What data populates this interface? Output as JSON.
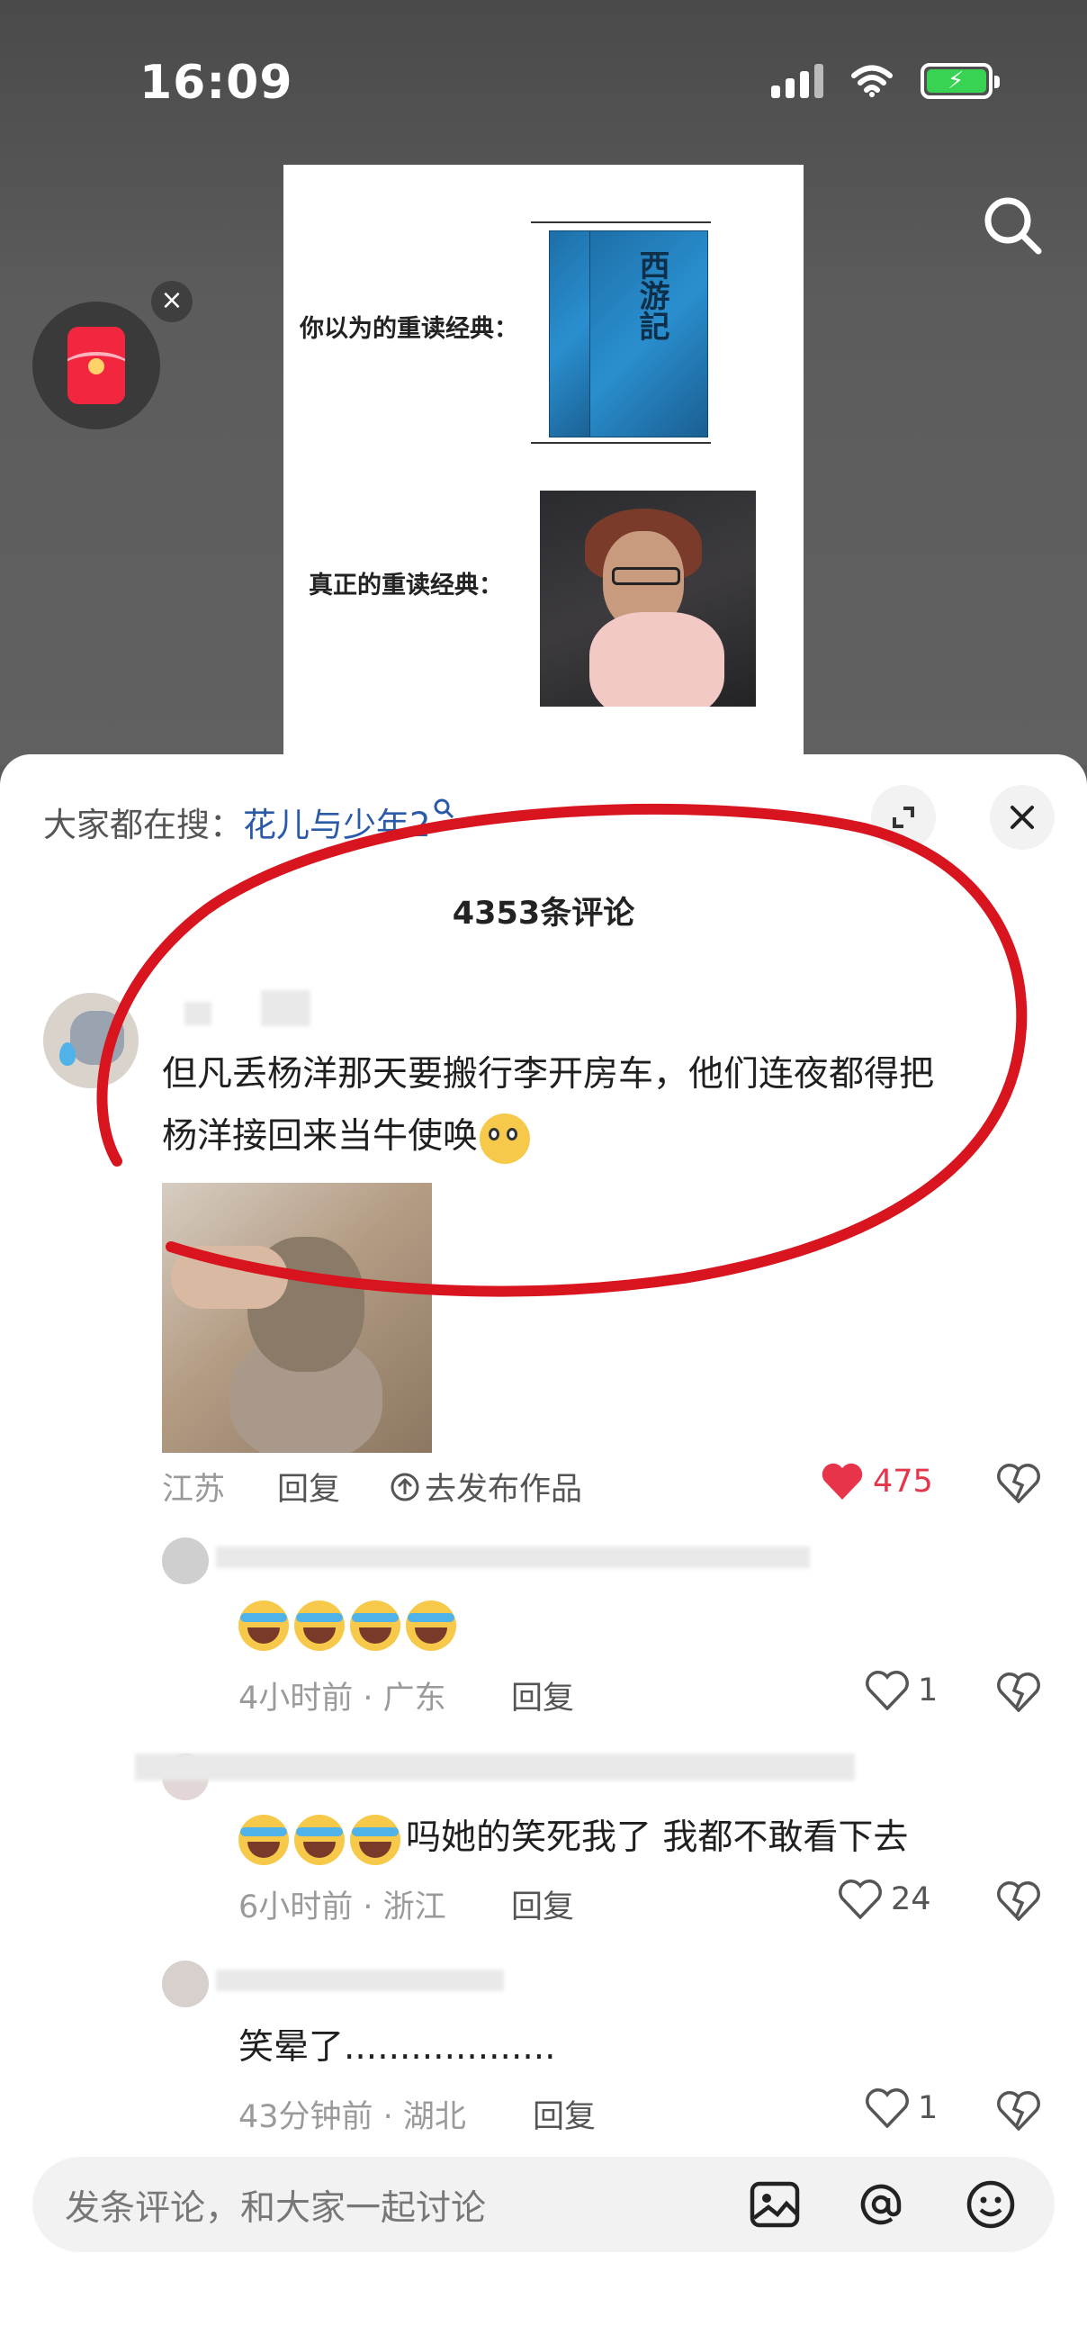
{
  "status_bar": {
    "time": "16:09"
  },
  "video": {
    "card_label_top": "你以为的重读经典：",
    "card_label_bottom": "真正的重读经典：",
    "book_title": "西游記"
  },
  "comments_sheet": {
    "hot_search_prefix": "大家都在搜：",
    "hot_search_keyword": "花儿与少年2",
    "count_label": "4353条评论",
    "main_comment": {
      "text_line1": "但凡丢杨洋那天要搬行李开房车，他们连夜都得把",
      "text_line2": "杨洋接回来当牛使唤",
      "location": "江苏",
      "reply_label": "回复",
      "publish_label": "去发布作品",
      "likes": "475"
    },
    "replies": [
      {
        "text": "",
        "meta": "4小时前 · 广东",
        "reply_label": "回复",
        "likes": "1"
      },
      {
        "text": "吗她的笑死我了  我都不敢看下去",
        "meta": "6小时前 · 浙江",
        "reply_label": "回复",
        "likes": "24"
      },
      {
        "text": "笑晕了...................",
        "meta": "43分钟前 · 湖北",
        "reply_label": "回复",
        "likes": "1"
      }
    ]
  },
  "input_bar": {
    "placeholder": "发条评论，和大家一起讨论"
  },
  "colors": {
    "accent_red": "#e8344a",
    "keyword_blue": "#2a5aa8",
    "annotation_red": "#d8141e"
  }
}
